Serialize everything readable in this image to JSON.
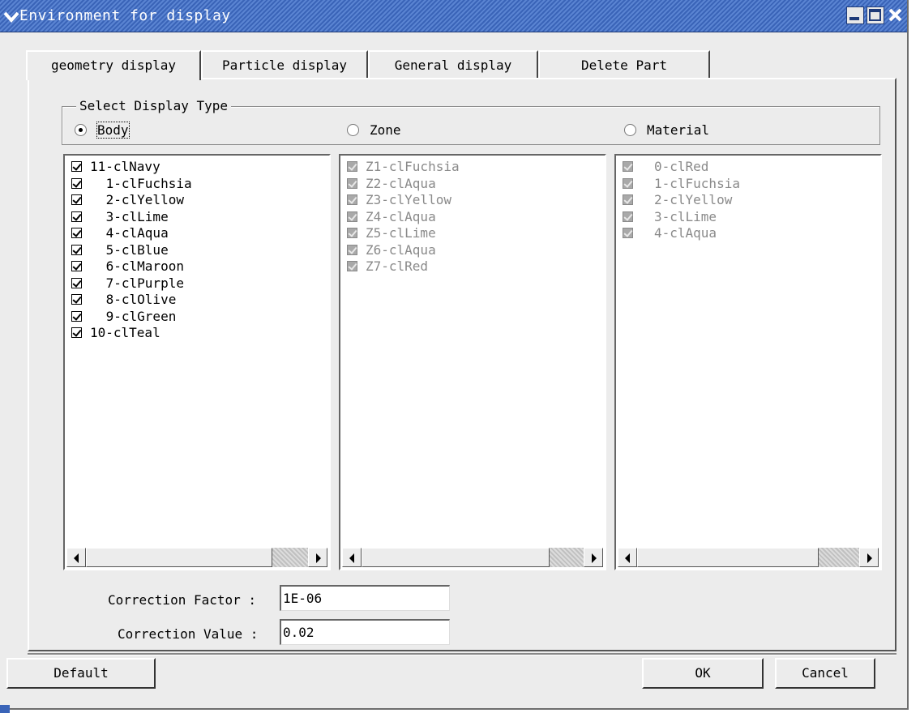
{
  "window": {
    "title": "Environment for display",
    "menu_icon": "chevron-down-icon",
    "minimize_icon": "minimize-icon",
    "maximize_icon": "maximize-icon",
    "close_icon": "close-icon",
    "title_bar_color": "#3a64b8"
  },
  "tabs": [
    {
      "label": "geometry display",
      "active": true
    },
    {
      "label": "Particle display",
      "active": false
    },
    {
      "label": "General display",
      "active": false
    },
    {
      "label": "Delete Part",
      "active": false
    }
  ],
  "display_type": {
    "legend": "Select Display Type",
    "selected": "Body",
    "options": [
      {
        "label": "Body",
        "checked": true
      },
      {
        "label": "Zone",
        "checked": false
      },
      {
        "label": "Material",
        "checked": false
      }
    ]
  },
  "lists": {
    "body": {
      "enabled": true,
      "items": [
        {
          "label": "11-clNavy",
          "checked": true
        },
        {
          "label": " 1-clFuchsia",
          "checked": true
        },
        {
          "label": " 2-clYellow",
          "checked": true
        },
        {
          "label": " 3-clLime",
          "checked": true
        },
        {
          "label": " 4-clAqua",
          "checked": true
        },
        {
          "label": " 5-clBlue",
          "checked": true
        },
        {
          "label": " 6-clMaroon",
          "checked": true
        },
        {
          "label": " 7-clPurple",
          "checked": true
        },
        {
          "label": " 8-clOlive",
          "checked": true
        },
        {
          "label": " 9-clGreen",
          "checked": true
        },
        {
          "label": "10-clTeal",
          "checked": true
        }
      ]
    },
    "zone": {
      "enabled": false,
      "items": [
        {
          "label": "Z1-clFuchsia",
          "checked": true
        },
        {
          "label": "Z2-clAqua",
          "checked": true
        },
        {
          "label": "Z3-clYellow",
          "checked": true
        },
        {
          "label": "Z4-clAqua",
          "checked": true
        },
        {
          "label": "Z5-clLime",
          "checked": true
        },
        {
          "label": "Z6-clAqua",
          "checked": true
        },
        {
          "label": "Z7-clRed",
          "checked": true
        }
      ]
    },
    "material": {
      "enabled": false,
      "items": [
        {
          "label": "0-clRed",
          "checked": true
        },
        {
          "label": "1-clFuchsia",
          "checked": true
        },
        {
          "label": "2-clYellow",
          "checked": true
        },
        {
          "label": "3-clLime",
          "checked": true
        },
        {
          "label": "4-clAqua",
          "checked": true
        }
      ]
    }
  },
  "correction": {
    "factor_label": "Correction Factor :",
    "factor_value": "1E-06",
    "value_label": "Correction Value :",
    "value_value": "0.02"
  },
  "buttons": {
    "default": "Default",
    "ok": "OK",
    "cancel": "Cancel"
  }
}
